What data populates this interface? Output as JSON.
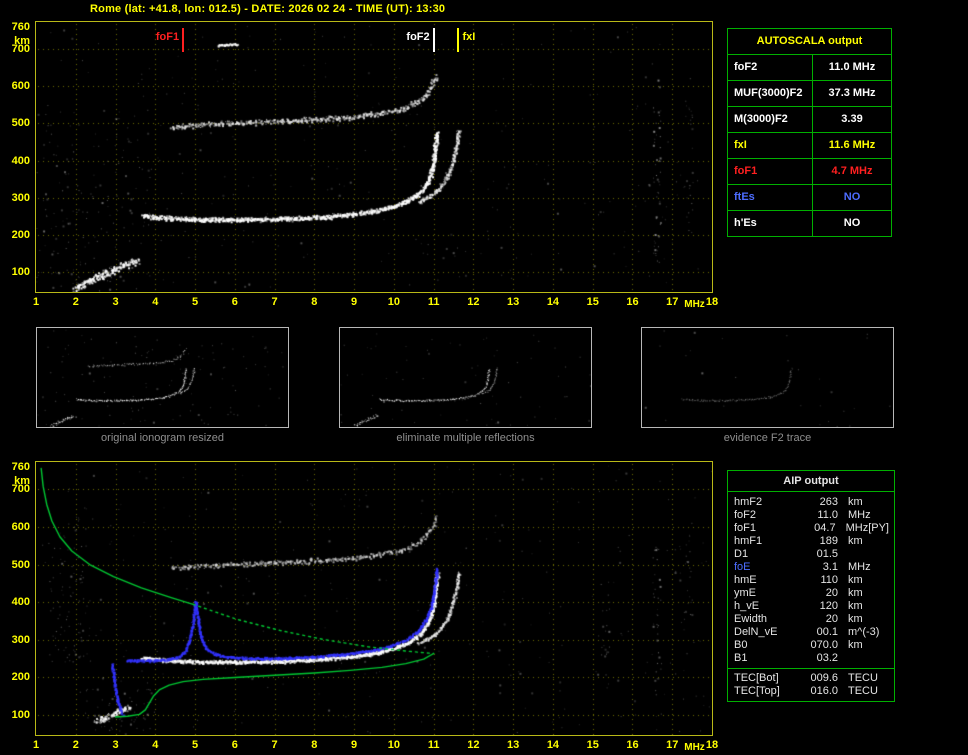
{
  "title": "Rome (lat: +41.8, lon: 012.5) - DATE: 2026 02 24 - TIME (UT): 13:30",
  "autoscala_table": {
    "header": "AUTOSCALA output",
    "rows": [
      {
        "label": "foF2",
        "value": "11.0 MHz",
        "color": "#ffffff"
      },
      {
        "label": "MUF(3000)F2",
        "value": "37.3 MHz",
        "color": "#ffffff"
      },
      {
        "label": "M(3000)F2",
        "value": "3.39",
        "color": "#ffffff"
      },
      {
        "label": "fxI",
        "value": "11.6 MHz",
        "color": "#ffff00"
      },
      {
        "label": "foF1",
        "value": "4.7 MHz",
        "color": "#ff2020"
      },
      {
        "label": "ftEs",
        "value": "NO",
        "color": "#4d6dff"
      },
      {
        "label": "h'Es",
        "value": "NO",
        "color": "#ffffff"
      }
    ]
  },
  "thumbnails": [
    {
      "caption": "original ionogram resized"
    },
    {
      "caption": "eliminate multiple reflections"
    },
    {
      "caption": "evidence F2 trace"
    }
  ],
  "aip_table": {
    "header": "AIP output",
    "rows": [
      {
        "name": "hmF2",
        "value": "263",
        "unit": "km"
      },
      {
        "name": "foF2",
        "value": "11.0",
        "unit": "MHz"
      },
      {
        "name": "foF1",
        "value": "04.7",
        "unit": "MHz",
        "extra": "[PY]"
      },
      {
        "name": "hmF1",
        "value": "189",
        "unit": "km"
      },
      {
        "name": "D1",
        "value": "01.5",
        "unit": ""
      },
      {
        "name": "foE",
        "value": "3.1",
        "unit": "MHz",
        "color": "#4d6dff"
      },
      {
        "name": "hmE",
        "value": "110",
        "unit": "km"
      },
      {
        "name": "ymE",
        "value": "20",
        "unit": "km"
      },
      {
        "name": "h_vE",
        "value": "120",
        "unit": "km"
      },
      {
        "name": "Ewidth",
        "value": "20",
        "unit": "km"
      },
      {
        "name": "DelN_vE",
        "value": "00.1",
        "unit": "m^(-3)"
      },
      {
        "name": "B0",
        "value": "070.0",
        "unit": "km"
      },
      {
        "name": "B1",
        "value": "03.2",
        "unit": ""
      }
    ],
    "tec_rows": [
      {
        "name": "TEC[Bot]",
        "value": "009.6",
        "unit": "TECU"
      },
      {
        "name": "TEC[Top]",
        "value": "016.0",
        "unit": "TECU"
      }
    ]
  },
  "chart_data": [
    {
      "id": "top_ionogram",
      "type": "scatter",
      "title": "autoscaled ionogram",
      "xlabel": "MHz",
      "ylabel": "km",
      "xlim": [
        1,
        18
      ],
      "ylim": [
        46,
        773
      ],
      "x_ticks": [
        1,
        2,
        3,
        4,
        5,
        6,
        7,
        8,
        9,
        10,
        11,
        12,
        13,
        14,
        15,
        16,
        17,
        18
      ],
      "y_ticks": [
        760,
        700,
        600,
        500,
        400,
        300,
        200,
        100
      ],
      "grid": true,
      "grid_color": "#6e6e00",
      "frame_color": "#b9b917",
      "markers": [
        {
          "label": "foF1",
          "mhz": 4.7,
          "color": "#ff2020",
          "side": "left"
        },
        {
          "label": "foF2",
          "mhz": 11.0,
          "color": "#ffffff",
          "side": "left"
        },
        {
          "label": "fxI",
          "mhz": 11.6,
          "color": "#ffff00",
          "side": "right"
        }
      ],
      "traces": [
        {
          "name": "E-region echo",
          "color": "#ffffff",
          "points": [
            [
              1.95,
              58
            ],
            [
              2.25,
              72
            ],
            [
              2.55,
              88
            ],
            [
              2.85,
              102
            ],
            [
              3.1,
              114
            ],
            [
              3.35,
              126
            ],
            [
              3.55,
              134
            ]
          ],
          "density": 3.2,
          "jitter": 4.5,
          "size": 2,
          "alpha": 0.95
        },
        {
          "name": "F o-trace",
          "color": "#ffffff",
          "points": [
            [
              3.65,
              252
            ],
            [
              4.3,
              246
            ],
            [
              5.2,
              242
            ],
            [
              6.2,
              242
            ],
            [
              7.2,
              244
            ],
            [
              8.2,
              249
            ],
            [
              9.0,
              257
            ],
            [
              9.6,
              267
            ],
            [
              10.0,
              278
            ],
            [
              10.35,
              293
            ],
            [
              10.65,
              315
            ],
            [
              10.85,
              345
            ],
            [
              10.97,
              388
            ],
            [
              11.03,
              432
            ],
            [
              11.08,
              478
            ]
          ],
          "density": 2.8,
          "jitter": 2.6,
          "size": 2,
          "alpha": 1
        },
        {
          "name": "F x-trace rise",
          "color": "#f0f0f0",
          "points": [
            [
              10.6,
              290
            ],
            [
              10.9,
              306
            ],
            [
              11.15,
              328
            ],
            [
              11.35,
              360
            ],
            [
              11.48,
              398
            ],
            [
              11.57,
              442
            ],
            [
              11.62,
              485
            ]
          ],
          "density": 1.9,
          "jitter": 2.2,
          "size": 2,
          "alpha": 0.9
        },
        {
          "name": "second hop trace",
          "color": "#e6e6e6",
          "points": [
            [
              4.4,
              492
            ],
            [
              5.3,
              499
            ],
            [
              6.2,
              503
            ],
            [
              7.1,
              507
            ],
            [
              8.0,
              512
            ],
            [
              8.9,
              518
            ],
            [
              9.6,
              527
            ],
            [
              10.2,
              540
            ],
            [
              10.6,
              560
            ],
            [
              10.9,
              592
            ],
            [
              11.05,
              628
            ]
          ],
          "density": 1.7,
          "jitter": 3.2,
          "size": 2,
          "alpha": 0.85
        },
        {
          "name": "stray echo",
          "color": "#ffffff",
          "points": [
            [
              5.55,
              712
            ],
            [
              6.05,
              714
            ]
          ],
          "density": 2.0,
          "jitter": 1.2,
          "size": 2,
          "alpha": 0.9
        }
      ],
      "noise": [
        {
          "n": 300,
          "x": [
            1,
            18
          ],
          "y": [
            50,
            765
          ],
          "alpha": 0.4,
          "size": 1
        },
        {
          "n": 150,
          "x": [
            1,
            3.9
          ],
          "y": [
            50,
            540
          ],
          "alpha": 0.5,
          "size": 1
        },
        {
          "n": 48,
          "x": [
            16.5,
            16.72
          ],
          "y": [
            120,
            620
          ],
          "alpha": 0.65,
          "size": 1
        },
        {
          "n": 26,
          "x": [
            17.3,
            17.52
          ],
          "y": [
            200,
            570
          ],
          "alpha": 0.5,
          "size": 1
        }
      ]
    },
    {
      "id": "restored_ionogram_with_profile",
      "type": "scatter",
      "title": "AIP restored traces and electron density profile",
      "xlabel": "MHz",
      "ylabel": "km",
      "xlim": [
        1,
        18
      ],
      "ylim": [
        46,
        773
      ],
      "x_ticks": [
        1,
        2,
        3,
        4,
        5,
        6,
        7,
        8,
        9,
        10,
        11,
        12,
        13,
        14,
        15,
        16,
        17,
        18
      ],
      "y_ticks": [
        760,
        700,
        600,
        500,
        400,
        300,
        200,
        100
      ],
      "grid": true,
      "grid_color": "#6e6e00",
      "frame_color": "#b9b917",
      "markers": [],
      "traces": [
        {
          "name": "E-region echo",
          "color": "#ffffff",
          "points": [
            [
              2.5,
              82
            ],
            [
              2.8,
              96
            ],
            [
              3.1,
              110
            ],
            [
              3.35,
              122
            ]
          ],
          "density": 2.6,
          "jitter": 3.5,
          "size": 2,
          "alpha": 0.9
        },
        {
          "name": "F o-trace restored",
          "color": "#ffffff",
          "points": [
            [
              3.65,
              252
            ],
            [
              4.3,
              246
            ],
            [
              5.2,
              242
            ],
            [
              6.2,
              242
            ],
            [
              7.2,
              244
            ],
            [
              8.2,
              249
            ],
            [
              9.0,
              257
            ],
            [
              9.6,
              267
            ],
            [
              10.0,
              278
            ],
            [
              10.35,
              293
            ],
            [
              10.65,
              315
            ],
            [
              10.85,
              345
            ],
            [
              10.97,
              388
            ],
            [
              11.03,
              432
            ],
            [
              11.08,
              478
            ]
          ],
          "density": 3.0,
          "jitter": 2.2,
          "size": 2,
          "alpha": 1
        },
        {
          "name": "F x-trace rise",
          "color": "#f0f0f0",
          "points": [
            [
              10.6,
              290
            ],
            [
              10.9,
              306
            ],
            [
              11.15,
              328
            ],
            [
              11.35,
              360
            ],
            [
              11.48,
              398
            ],
            [
              11.57,
              442
            ],
            [
              11.62,
              485
            ]
          ],
          "density": 1.8,
          "jitter": 2.0,
          "size": 2,
          "alpha": 0.85
        },
        {
          "name": "second hop trace",
          "color": "#dedede",
          "points": [
            [
              4.4,
              492
            ],
            [
              5.3,
              499
            ],
            [
              6.2,
              503
            ],
            [
              7.1,
              507
            ],
            [
              8.0,
              512
            ],
            [
              8.9,
              518
            ],
            [
              9.6,
              527
            ],
            [
              10.2,
              540
            ],
            [
              10.6,
              560
            ],
            [
              10.9,
              592
            ],
            [
              11.05,
              628
            ]
          ],
          "density": 1.5,
          "jitter": 3.0,
          "size": 2,
          "alpha": 0.7
        },
        {
          "name": "AIP fitted trace E-tail",
          "color": "#3333ff",
          "points": [
            [
              2.9,
              238
            ],
            [
              2.95,
              196
            ],
            [
              3.0,
              160
            ],
            [
              3.07,
              126
            ],
            [
              3.17,
              100
            ]
          ],
          "density": 2.2,
          "jitter": 1.4,
          "size": 2,
          "alpha": 0.95
        },
        {
          "name": "AIP fitted trace F",
          "color": "#3333ff",
          "points": [
            [
              3.25,
              246
            ],
            [
              3.8,
              245
            ],
            [
              4.3,
              248
            ],
            [
              4.6,
              256
            ],
            [
              4.75,
              272
            ],
            [
              4.85,
              302
            ],
            [
              4.92,
              340
            ],
            [
              4.97,
              376
            ],
            [
              5.0,
              402
            ],
            [
              5.04,
              370
            ],
            [
              5.1,
              328
            ],
            [
              5.18,
              296
            ],
            [
              5.3,
              274
            ],
            [
              5.5,
              262
            ],
            [
              5.9,
              254
            ],
            [
              6.5,
              251
            ],
            [
              7.2,
              252
            ],
            [
              8.0,
              256
            ],
            [
              8.8,
              263
            ],
            [
              9.4,
              272
            ],
            [
              9.9,
              284
            ],
            [
              10.3,
              301
            ],
            [
              10.6,
              324
            ],
            [
              10.8,
              354
            ],
            [
              10.95,
              398
            ],
            [
              11.02,
              446
            ],
            [
              11.07,
              492
            ]
          ],
          "density": 2.4,
          "jitter": 1.4,
          "size": 2,
          "alpha": 0.95
        }
      ],
      "profiles": [
        {
          "name": "electron density profile topside",
          "color": "#00c832",
          "style": "solid",
          "width": 1.4,
          "points": [
            [
              1.13,
              756
            ],
            [
              1.18,
              708
            ],
            [
              1.27,
              660
            ],
            [
              1.4,
              616
            ],
            [
              1.6,
              574
            ],
            [
              1.9,
              536
            ],
            [
              2.35,
              500
            ],
            [
              2.95,
              468
            ],
            [
              3.65,
              438
            ],
            [
              4.4,
              412
            ],
            [
              4.95,
              394
            ]
          ]
        },
        {
          "name": "electron density profile extrapolated",
          "color": "#00c832",
          "style": "dotted",
          "width": 1.4,
          "points": [
            [
              4.95,
              394
            ],
            [
              6.05,
              354
            ],
            [
              7.15,
              324
            ],
            [
              8.25,
              300
            ],
            [
              9.35,
              281
            ],
            [
              10.35,
              269
            ],
            [
              11.0,
              263
            ]
          ]
        },
        {
          "name": "electron density profile bottomside",
          "color": "#00c832",
          "style": "solid",
          "width": 1.4,
          "points": [
            [
              11.0,
              263
            ],
            [
              10.75,
              248
            ],
            [
              10.3,
              236
            ],
            [
              9.7,
              226
            ],
            [
              8.9,
              218
            ],
            [
              8.0,
              211
            ],
            [
              7.0,
              205
            ],
            [
              6.0,
              199
            ],
            [
              5.2,
              194
            ],
            [
              4.7,
              188
            ],
            [
              4.35,
              179
            ],
            [
              4.1,
              166
            ],
            [
              3.95,
              149
            ],
            [
              3.85,
              131
            ],
            [
              3.75,
              113
            ],
            [
              3.6,
              101
            ],
            [
              3.3,
              96
            ],
            [
              3.0,
              94
            ]
          ]
        }
      ],
      "noise": [
        {
          "n": 320,
          "x": [
            1,
            18
          ],
          "y": [
            50,
            765
          ],
          "alpha": 0.38,
          "size": 1
        },
        {
          "n": 90,
          "x": [
            1.3,
            2.35
          ],
          "y": [
            240,
            630
          ],
          "alpha": 0.5,
          "size": 1
        },
        {
          "n": 60,
          "x": [
            2.2,
            3.9
          ],
          "y": [
            50,
            170
          ],
          "alpha": 0.5,
          "size": 1
        },
        {
          "n": 26,
          "x": [
            15.2,
            15.42
          ],
          "y": [
            160,
            460
          ],
          "alpha": 0.5,
          "size": 1
        },
        {
          "n": 34,
          "x": [
            16.5,
            16.72
          ],
          "y": [
            150,
            560
          ],
          "alpha": 0.55,
          "size": 1
        },
        {
          "n": 22,
          "x": [
            17.28,
            17.5
          ],
          "y": [
            260,
            600
          ],
          "alpha": 0.5,
          "size": 1
        }
      ]
    }
  ]
}
